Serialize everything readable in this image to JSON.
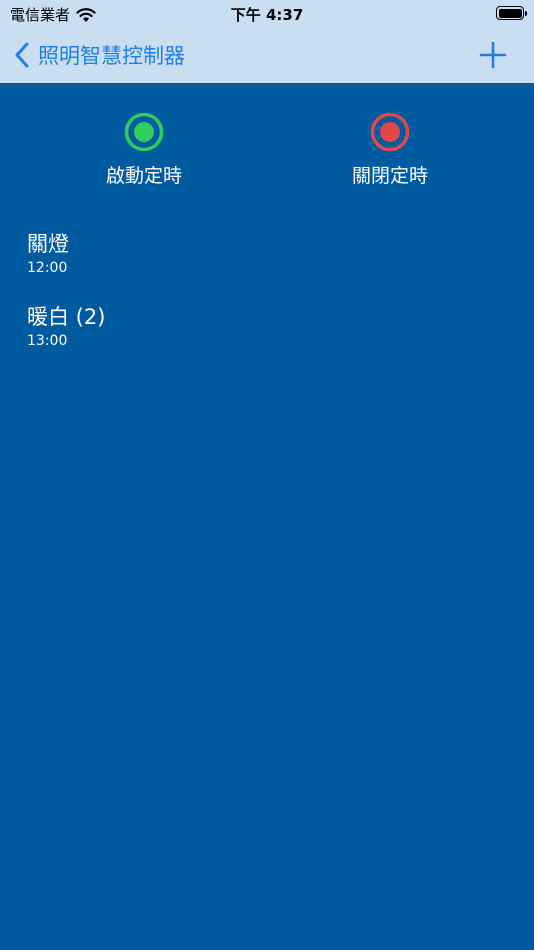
{
  "status_bar": {
    "carrier": "電信業者",
    "time": "下午 4:37"
  },
  "nav": {
    "title": "照明智慧控制器"
  },
  "timers": {
    "start_label": "啟動定時",
    "stop_label": "關閉定時"
  },
  "schedules": [
    {
      "name": "關燈",
      "time": "12:00"
    },
    {
      "name": "暖白 (2)",
      "time": "13:00"
    }
  ],
  "colors": {
    "background": "#005aa0",
    "bar": "#c9def1",
    "accent": "#1f7fe6",
    "start": "#2ecc5a",
    "stop": "#e04848"
  }
}
